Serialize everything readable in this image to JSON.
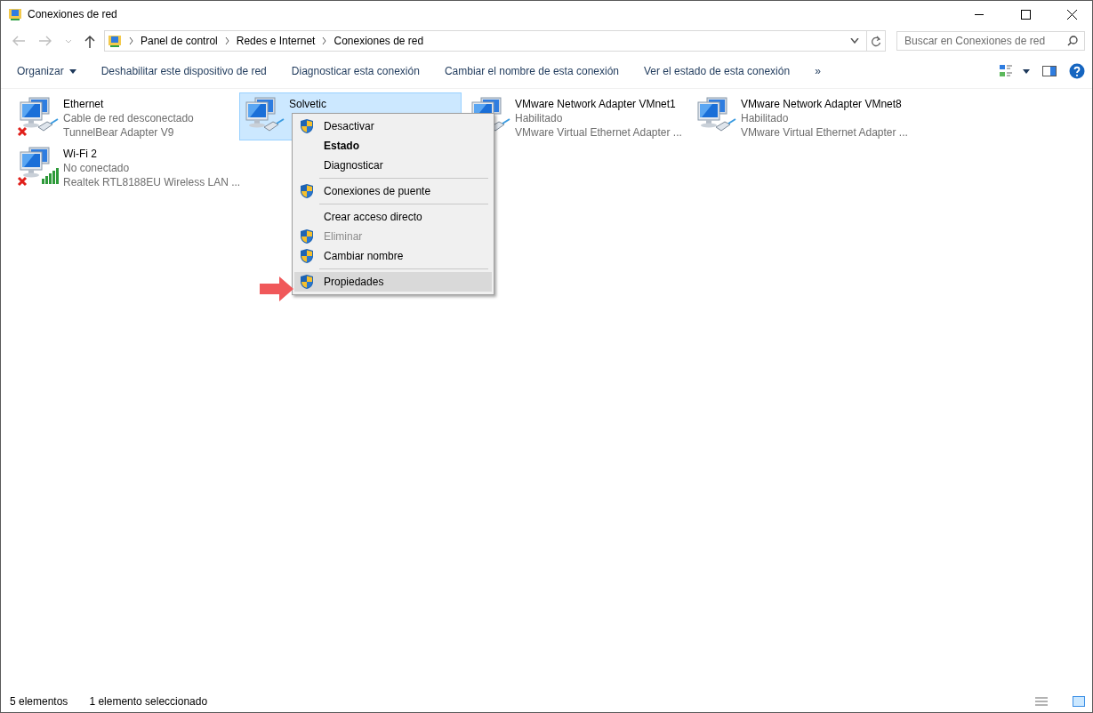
{
  "window": {
    "title": "Conexiones de red"
  },
  "address_bar": {
    "breadcrumbs": [
      "Panel de control",
      "Redes e Internet",
      "Conexiones de red"
    ]
  },
  "search": {
    "placeholder": "Buscar en Conexiones de red"
  },
  "toolbar": {
    "items": [
      {
        "label": "Organizar",
        "dropdown": true
      },
      {
        "label": "Deshabilitar este dispositivo de red",
        "dropdown": false
      },
      {
        "label": "Diagnosticar esta conexión",
        "dropdown": false
      },
      {
        "label": "Cambiar el nombre de esta conexión",
        "dropdown": false
      },
      {
        "label": "Ver el estado de esta conexión",
        "dropdown": false
      },
      {
        "label": "»",
        "dropdown": false
      }
    ]
  },
  "connections": [
    {
      "name": "Ethernet",
      "status": "Cable de red desconectado",
      "adapter": "TunnelBear Adapter V9",
      "kind": "ethernet",
      "connected": false,
      "selected": false
    },
    {
      "name": "Solvetic",
      "kind": "ethernet",
      "connected": true,
      "selected": true
    },
    {
      "name": "VMware Network Adapter VMnet1",
      "status": "Habilitado",
      "adapter": "VMware Virtual Ethernet Adapter ...",
      "kind": "ethernet",
      "selected": false
    },
    {
      "name": "VMware Network Adapter VMnet8",
      "status": "Habilitado",
      "adapter": "VMware Virtual Ethernet Adapter ...",
      "kind": "ethernet",
      "connected": true,
      "selected": false
    },
    {
      "name": "Wi-Fi 2",
      "status": "No conectado",
      "adapter": "Realtek RTL8188EU Wireless LAN ...",
      "kind": "wifi",
      "connected": false,
      "selected": false
    }
  ],
  "context_menu": {
    "items": [
      {
        "kind": "item",
        "label": "Desactivar",
        "shield": true,
        "bold": false,
        "disabled": false,
        "highlighted": false
      },
      {
        "kind": "item",
        "label": "Estado",
        "shield": false,
        "bold": true,
        "disabled": false,
        "highlighted": false
      },
      {
        "kind": "item",
        "label": "Diagnosticar",
        "shield": false,
        "bold": false,
        "disabled": false,
        "highlighted": false
      },
      {
        "kind": "separator"
      },
      {
        "kind": "item",
        "label": "Conexiones de puente",
        "shield": true,
        "bold": false,
        "disabled": false,
        "highlighted": false
      },
      {
        "kind": "separator"
      },
      {
        "kind": "item",
        "label": "Crear acceso directo",
        "shield": false,
        "bold": false,
        "disabled": false,
        "highlighted": false
      },
      {
        "kind": "item",
        "label": "Eliminar",
        "shield": true,
        "bold": false,
        "disabled": true,
        "highlighted": false
      },
      {
        "kind": "item",
        "label": "Cambiar nombre",
        "shield": true,
        "bold": false,
        "disabled": false,
        "highlighted": false
      },
      {
        "kind": "separator"
      },
      {
        "kind": "item",
        "label": "Propiedades",
        "shield": true,
        "bold": false,
        "disabled": false,
        "highlighted": true
      }
    ]
  },
  "status_bar": {
    "count": "5 elementos",
    "selection": "1 elemento seleccionado"
  }
}
